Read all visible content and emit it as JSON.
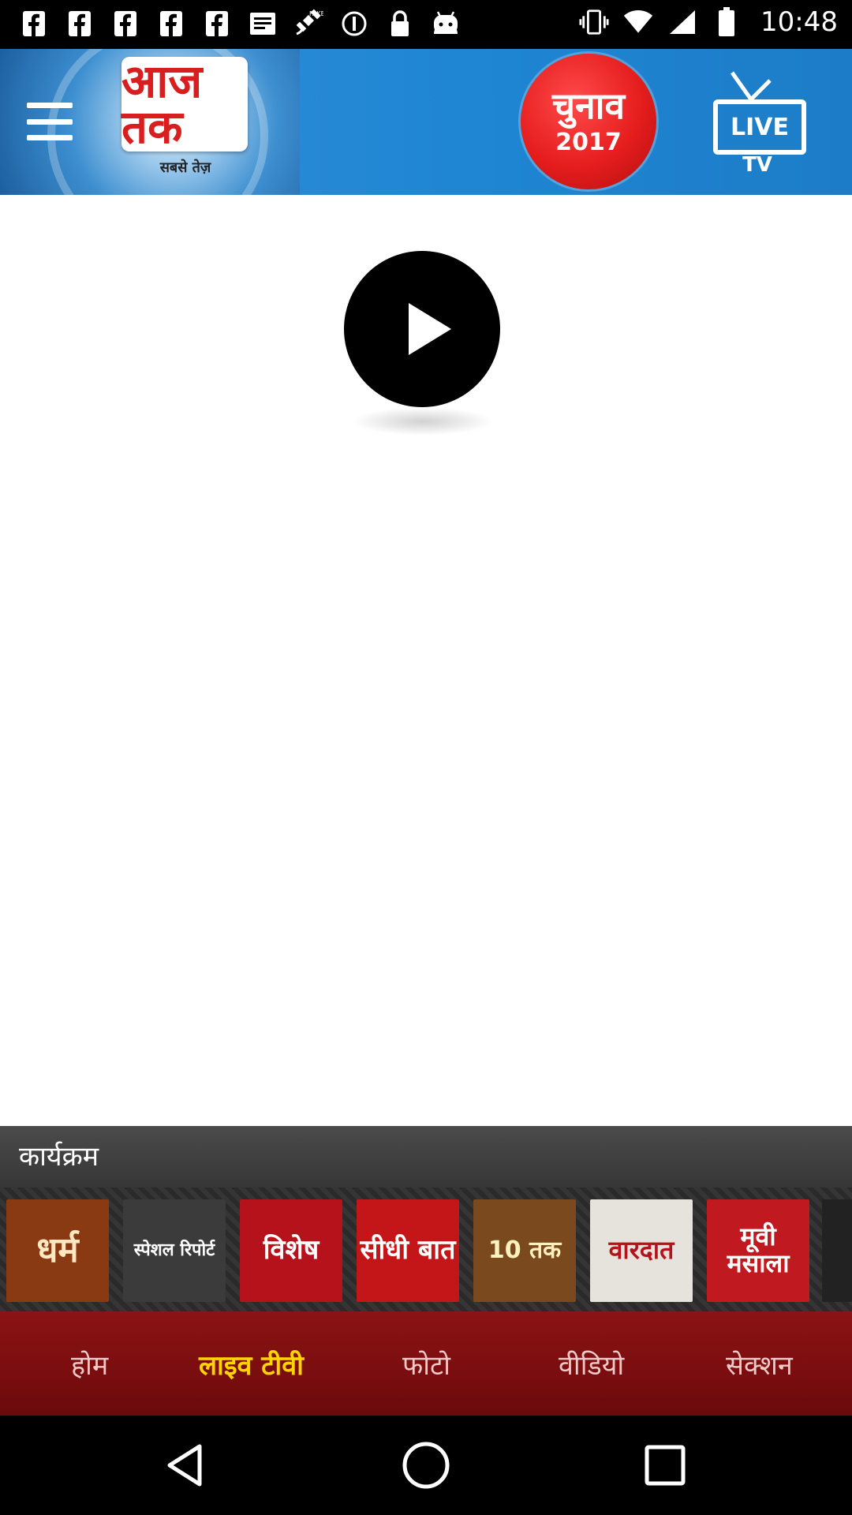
{
  "status_bar": {
    "time": "10:48",
    "icons": [
      "facebook-icon",
      "facebook-icon",
      "facebook-icon",
      "facebook-icon",
      "facebook-icon",
      "message-icon",
      "fake-gps-icon",
      "circle-icon",
      "lock-icon",
      "android-icon"
    ]
  },
  "header": {
    "logo_text": "आज तक",
    "logo_tagline": "सबसे तेज़",
    "election_title": "चुनाव",
    "election_year": "2017",
    "live_label": "LIVE",
    "tv_label": "TV"
  },
  "programs": {
    "title": "कार्यक्रम",
    "items": [
      {
        "label": "धर्म",
        "bg": "#8a3a12",
        "fg": "#ffe7c2"
      },
      {
        "label": "स्पेशल रिपोर्ट",
        "bg": "#3b3b3b",
        "fg": "#ffffff"
      },
      {
        "label": "विशेष",
        "bg": "#b5121b",
        "fg": "#ffffff"
      },
      {
        "label": "सीधी बात",
        "bg": "#c41518",
        "fg": "#ffffff"
      },
      {
        "label": "10 तक",
        "bg": "#7a4a1e",
        "fg": "#fff2c0"
      },
      {
        "label": "वारदात",
        "bg": "#e6e2dc",
        "fg": "#b5121b"
      },
      {
        "label": "मूवी मसाला",
        "bg": "#c01a20",
        "fg": "#ffffff"
      }
    ]
  },
  "bottom_nav": {
    "items": [
      {
        "label": "होम"
      },
      {
        "label": "लाइव टीवी"
      },
      {
        "label": "फोटो"
      },
      {
        "label": "वीडियो"
      },
      {
        "label": "सेक्शन"
      }
    ],
    "active": "लाइव टीवी"
  },
  "colors": {
    "header_blue": "#1e86d3",
    "brand_red": "#d81e1e",
    "nav_bg": "#7a0d0f",
    "nav_active": "#ffd400"
  }
}
